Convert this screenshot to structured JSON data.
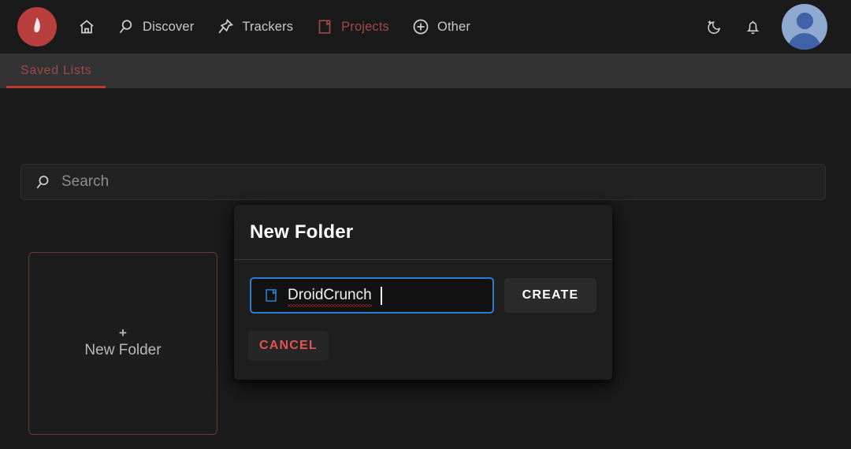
{
  "topnav": {
    "logo_icon": "app-logo-icon",
    "logo_color": "#b93f3f",
    "items": [
      {
        "label": "",
        "icon": "home-icon",
        "active": false
      },
      {
        "label": "Discover",
        "icon": "search-icon",
        "active": false
      },
      {
        "label": "Trackers",
        "icon": "pin-icon",
        "active": false
      },
      {
        "label": "Projects",
        "icon": "notebook-icon",
        "active": true
      },
      {
        "label": "Other",
        "icon": "plus-circle-icon",
        "active": false
      }
    ],
    "right": {
      "theme_toggle_icon": "moon-sparkle-icon",
      "notifications_icon": "bell-icon",
      "avatar_icon": "user-avatar"
    },
    "active_color": "#9e4a4a"
  },
  "tabbar": {
    "tabs": [
      {
        "label": "Saved Lists",
        "active": true
      }
    ],
    "accent_color": "#c0392b"
  },
  "search": {
    "icon": "search-icon",
    "placeholder": "Search",
    "value": ""
  },
  "folders": {
    "new_folder_card": {
      "plus": "+",
      "label": "New Folder",
      "border_color": "#6e3535"
    }
  },
  "dialog": {
    "title": "New Folder",
    "input": {
      "icon": "notebook-icon",
      "value": "DroidCrunch",
      "placeholder": "",
      "focus_color": "#2a7fd4",
      "spellcheck_error": true
    },
    "create_label": "CREATE",
    "cancel_label": "CANCEL",
    "cancel_color": "#e25353"
  }
}
